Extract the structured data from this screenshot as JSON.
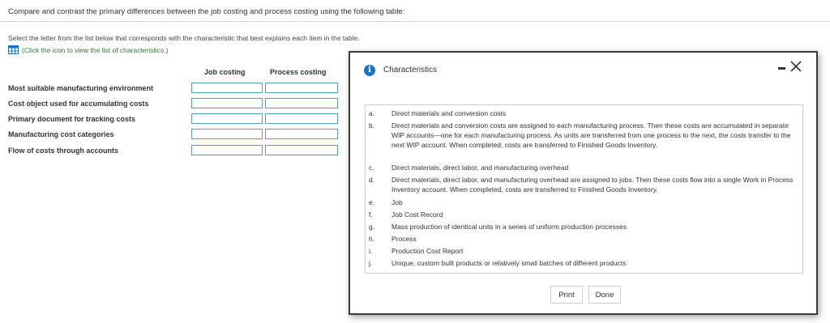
{
  "header": {
    "question": "Compare and contrast the primary differences between the job costing and process costing using the following table:"
  },
  "instructions": {
    "text": "Select the letter from the list below that corresponds with the characteristic that best explains each item in the table.",
    "link_text": "(Click the icon to view the list of characteristics.)"
  },
  "table": {
    "columns": [
      "Job costing",
      "Process costing"
    ],
    "rows": [
      {
        "label": "Most suitable manufacturing environment",
        "job_value": "",
        "process_value": ""
      },
      {
        "label": "Cost object used for accumulating costs",
        "job_value": "",
        "process_value": ""
      },
      {
        "label": "Primary document for tracking costs",
        "job_value": "",
        "process_value": ""
      },
      {
        "label": "Manufacturing cost categories",
        "job_value": "",
        "process_value": ""
      },
      {
        "label": "Flow of costs through accounts",
        "job_value": "",
        "process_value": ""
      }
    ]
  },
  "modal": {
    "title": "Characteristics",
    "items": [
      {
        "letter": "a.",
        "text": "Direct materials and conversion costs"
      },
      {
        "letter": "b.",
        "text": "Direct materials and conversion costs are assigned to each manufacturing process. Then these costs are accumulated in separate WIP accounts—one for each manufacturing process. As units are transferred from one process to the next, the costs transfer to the next WIP account. When completed, costs are transferred to Finished Goods Inventory."
      },
      {
        "letter": "c.",
        "text": "Direct materials, direct labor, and manufacturing overhead"
      },
      {
        "letter": "d.",
        "text": "Direct materials, direct labor, and manufacturing overhead are assigned to jobs. Then these costs flow into a single Work in Process Inventory account. When completed, costs are transferred to Finished Goods Inventory."
      },
      {
        "letter": "e.",
        "text": "Job"
      },
      {
        "letter": "f.",
        "text": "Job Cost Record"
      },
      {
        "letter": "g.",
        "text": "Mass production of identical units in a series of uniform production processes"
      },
      {
        "letter": "h.",
        "text": "Process"
      },
      {
        "letter": "i.",
        "text": "Production Cost Report"
      },
      {
        "letter": "j.",
        "text": "Unique, custom built products or relatively small batches of different products"
      }
    ],
    "print_label": "Print",
    "done_label": "Done"
  },
  "colors": {
    "link_green": "#2e7d32",
    "info_blue": "#1a73c8",
    "input_border": "#4f9fbf"
  }
}
